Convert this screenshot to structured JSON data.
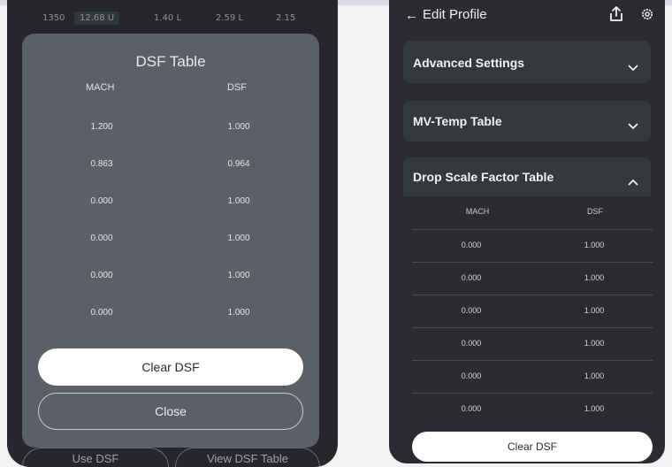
{
  "left": {
    "background_row": [
      "1350",
      "12.68 U",
      "1.40 L",
      "2.59 L",
      "2.15"
    ],
    "modal": {
      "title": "DSF Table",
      "col_mach": "MACH",
      "col_dsf": "DSF",
      "rows": [
        {
          "mach": "1.200",
          "dsf": "1.000"
        },
        {
          "mach": "0.863",
          "dsf": "0.964"
        },
        {
          "mach": "0.000",
          "dsf": "1.000"
        },
        {
          "mach": "0.000",
          "dsf": "1.000"
        },
        {
          "mach": "0.000",
          "dsf": "1.000"
        },
        {
          "mach": "0.000",
          "dsf": "1.000"
        }
      ],
      "clear_label": "Clear DSF",
      "close_label": "Close"
    },
    "bottom": {
      "use_dsf": "Use DSF",
      "view_dsf_table": "View DSF Table"
    }
  },
  "right": {
    "header": {
      "title": "Edit Profile",
      "back_icon": "arrow-left-icon",
      "share_icon": "share-icon",
      "settings_icon": "gear-icon"
    },
    "sections": [
      {
        "title": "Advanced Settings",
        "expanded": false
      },
      {
        "title": "MV-Temp Table",
        "expanded": false
      },
      {
        "title": "Drop Scale Factor Table",
        "expanded": true
      }
    ],
    "table": {
      "col_mach": "MACH",
      "col_dsf": "DSF",
      "rows": [
        {
          "mach": "0.000",
          "dsf": "1.000"
        },
        {
          "mach": "0.000",
          "dsf": "1.000"
        },
        {
          "mach": "0.000",
          "dsf": "1.000"
        },
        {
          "mach": "0.000",
          "dsf": "1.000"
        },
        {
          "mach": "0.000",
          "dsf": "1.000"
        },
        {
          "mach": "0.000",
          "dsf": "1.000"
        }
      ],
      "clear_label": "Clear DSF"
    }
  },
  "colors": {
    "page_background": "#f2f3f5",
    "phone_dark": "#25272b",
    "modal_grey": "#5c6066",
    "card_grey": "#35383d",
    "button_white": "#ffffff"
  }
}
